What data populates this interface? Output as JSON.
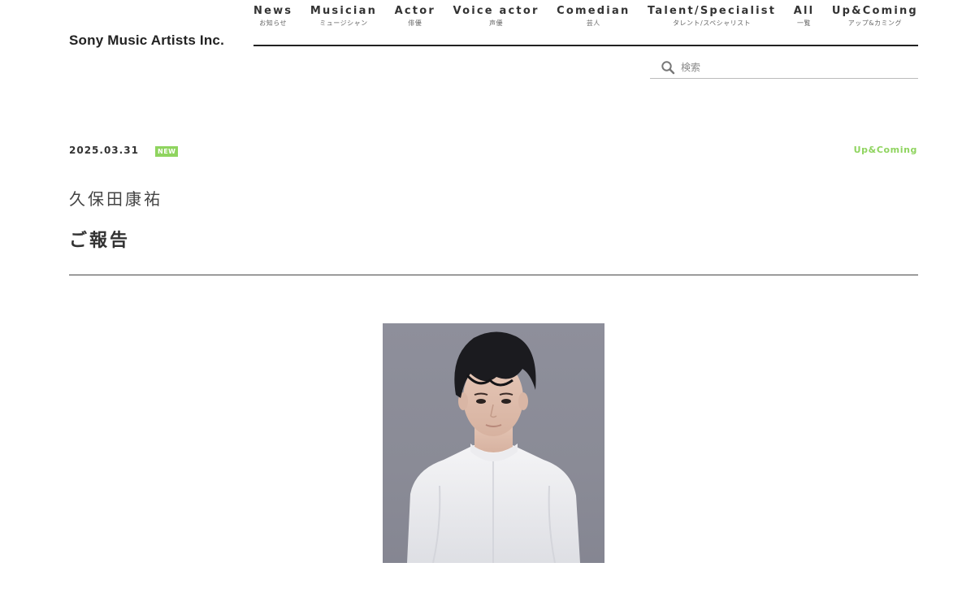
{
  "header": {
    "logo": "Sony Music Artists Inc.",
    "nav": [
      {
        "en": "News",
        "ja": "お知らせ"
      },
      {
        "en": "Musician",
        "ja": "ミュージシャン"
      },
      {
        "en": "Actor",
        "ja": "俳優"
      },
      {
        "en": "Voice actor",
        "ja": "声優"
      },
      {
        "en": "Comedian",
        "ja": "芸人"
      },
      {
        "en": "Talent/Specialist",
        "ja": "タレント/スペシャリスト"
      },
      {
        "en": "All",
        "ja": "一覧"
      },
      {
        "en": "Up&Coming",
        "ja": "アップ&カミング"
      }
    ],
    "search": {
      "placeholder": "検索",
      "icon": "search-icon"
    }
  },
  "article": {
    "date": "2025.03.31",
    "badge": "NEW",
    "category": "Up&Coming",
    "artist_name": "久保田康祐",
    "title": "ご報告"
  },
  "colors": {
    "accent_green": "#8fd45f",
    "text_dark": "#222222",
    "photo_background": "#8e8f9b"
  }
}
